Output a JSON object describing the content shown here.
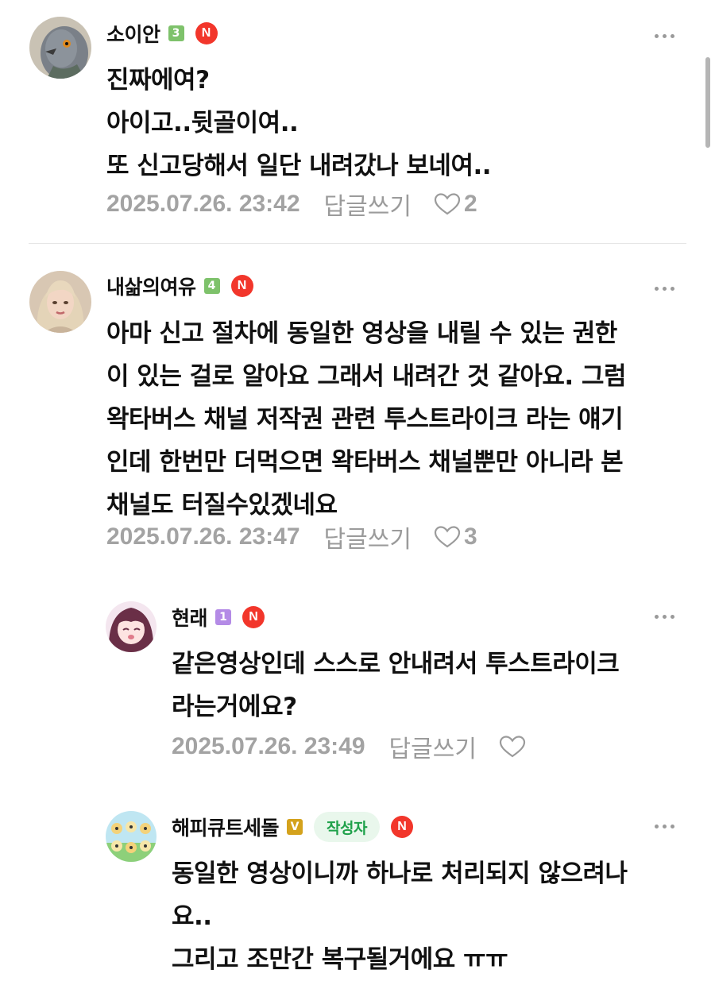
{
  "comments": [
    {
      "nickname": "소이안",
      "level": "3",
      "badge_n": "N",
      "text": "진짜에여?\n아이고..뒷골이여..\n또 신고당해서 일단 내려갔나 보네여..",
      "date": "2025.07.26. 23:42",
      "reply_label": "답글쓰기",
      "likes": "2"
    },
    {
      "nickname": "내삶의여유",
      "level": "4",
      "badge_n": "N",
      "text": "아마 신고 절차에 동일한 영상을 내릴 수 있는 권한\n이 있는 걸로 알아요 그래서 내려간 것 같아요. 그럼\n왁타버스 채널 저작권 관련 투스트라이크 라는 얘기\n인데 한번만 더먹으면 왁타버스 채널뿐만 아니라 본\n채널도 터질수있겠네요",
      "date": "2025.07.26. 23:47",
      "reply_label": "답글쓰기",
      "likes": "3"
    },
    {
      "nickname": "현래",
      "level": "1",
      "badge_n": "N",
      "text": "같은영상인데 스스로 안내려서 투스트라이크\n라는거에요?",
      "date": "2025.07.26. 23:49",
      "reply_label": "답글쓰기",
      "likes": ""
    },
    {
      "nickname": "해피큐트세돌",
      "level": "V",
      "author_label": "작성자",
      "badge_n": "N",
      "text": "동일한 영상이니까 하나로 처리되지 않으려나\n요..\n그리고 조만간 복구될거에요 ㅠㅠ"
    }
  ],
  "colors": {
    "level_3": "#7ec26b",
    "level_4": "#7ec26b",
    "level_1": "#b48be6",
    "level_v": "#d4a21c",
    "badge_n": "#f2362b",
    "author_badge_bg": "#e9f7ec",
    "author_badge_text": "#1fa14a"
  },
  "icons": {
    "more": "more-dots-icon",
    "like": "heart-outline-icon"
  }
}
